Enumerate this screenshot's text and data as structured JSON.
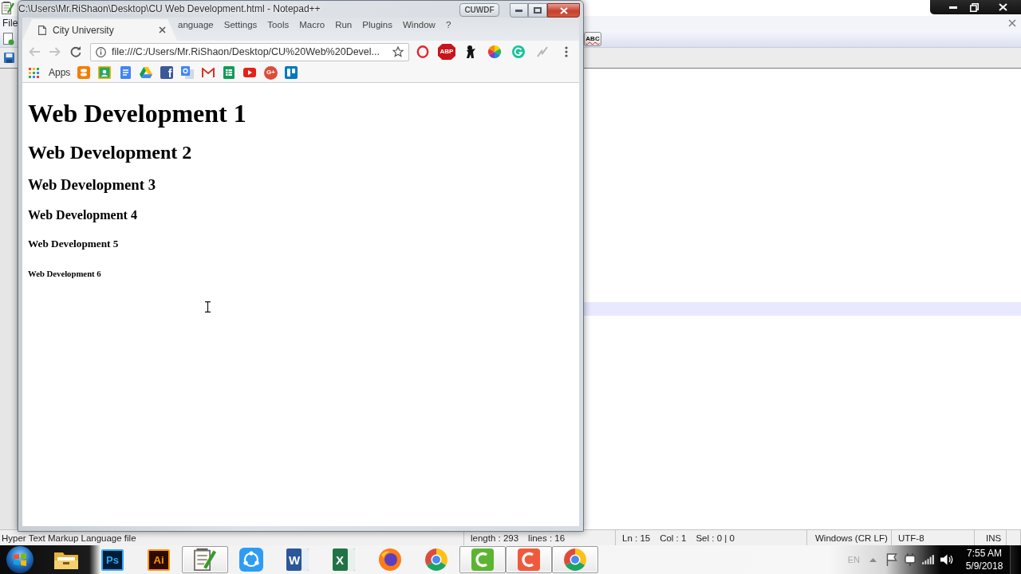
{
  "editor_window": {
    "menu": [
      "File"
    ],
    "spellcheck_label": "ABC",
    "status_bar": {
      "file_type": "Hyper Text Markup Language file",
      "length": "length : 293",
      "lines": "lines : 16",
      "position": [
        "Ln : 15",
        "Col : 1",
        "Sel : 0 | 0"
      ],
      "line_ending": "Windows (CR LF)",
      "encoding": "UTF-8",
      "mode": "INS"
    }
  },
  "floating_window": {
    "title": "C:\\Users\\Mr.RiShaon\\Desktop\\CU Web Development.html - Notepad++",
    "title_button": "CUWDF",
    "menu": [
      "anguage",
      "Settings",
      "Tools",
      "Macro",
      "Run",
      "Plugins",
      "Window",
      "?"
    ]
  },
  "browser": {
    "tab": {
      "title": "City University"
    },
    "nav": [
      {
        "kind": "back",
        "disabled": true
      },
      {
        "kind": "forward",
        "disabled": true
      },
      {
        "kind": "reload",
        "disabled": false
      }
    ],
    "address": "file:///C:/Users/Mr.RiShaon/Desktop/CU%20Web%20Devel...",
    "extensions": [
      {
        "kind": "opera"
      },
      {
        "kind": "adblock",
        "label": "ABP"
      },
      {
        "kind": "ninja"
      },
      {
        "kind": "color_wheel"
      },
      {
        "kind": "grammarly"
      },
      {
        "kind": "pen"
      }
    ],
    "bookmarks": [
      {
        "kind": "apps",
        "label": "Apps"
      },
      {
        "kind": "blogger"
      },
      {
        "kind": "classroom"
      },
      {
        "kind": "docs"
      },
      {
        "kind": "drive"
      },
      {
        "kind": "facebook",
        "label": "f"
      },
      {
        "kind": "translate"
      },
      {
        "kind": "gmail"
      },
      {
        "kind": "sheets"
      },
      {
        "kind": "youtube"
      },
      {
        "kind": "google_plus",
        "label": "G+"
      },
      {
        "kind": "trello"
      }
    ]
  },
  "page": {
    "headings": [
      {
        "kind": "h1",
        "text": "Web Development 1"
      },
      {
        "kind": "h2",
        "text": "Web Development 2"
      },
      {
        "kind": "h3",
        "text": "Web Development 3"
      },
      {
        "kind": "h4",
        "text": "Web Development 4"
      },
      {
        "kind": "h5",
        "text": "Web Development 5"
      },
      {
        "kind": "h6",
        "text": "Web Development 6"
      }
    ]
  },
  "taskbar": {
    "apps": [
      {
        "kind": "start",
        "running": false
      },
      {
        "kind": "folder",
        "running": false
      },
      {
        "kind": "photoshop",
        "label": "Ps",
        "running": false
      },
      {
        "kind": "illustrator",
        "label": "Ai",
        "running": false
      },
      {
        "kind": "notepad",
        "running": true
      },
      {
        "kind": "shareit",
        "running": false
      },
      {
        "kind": "word",
        "label": "W",
        "running": false
      },
      {
        "kind": "excel",
        "label": "X",
        "running": false
      },
      {
        "kind": "firefox",
        "running": false
      },
      {
        "kind": "chrome",
        "running": false
      },
      {
        "kind": "camtasia",
        "running": true
      },
      {
        "kind": "camtasia_recorder",
        "running": true
      },
      {
        "kind": "chrome",
        "running": true
      }
    ],
    "tray": {
      "language": "EN",
      "time": "7:55 AM",
      "date": "5/9/2018"
    }
  }
}
